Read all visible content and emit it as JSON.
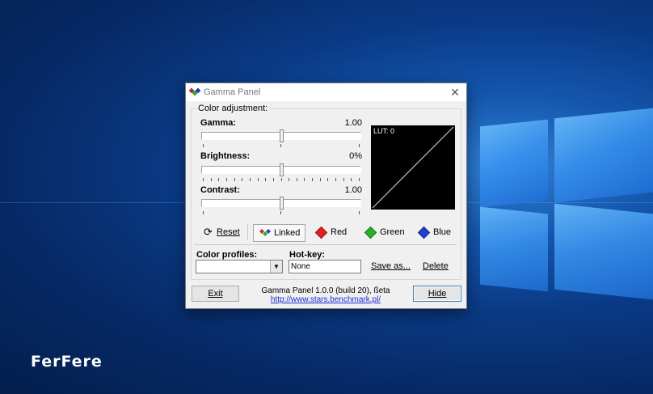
{
  "window": {
    "title": "Gamma Panel",
    "close_glyph": "✕"
  },
  "color_adjustment": {
    "group_title": "Color adjustment:",
    "gamma": {
      "label": "Gamma:",
      "value": "1.00",
      "level": 0.5
    },
    "brightness": {
      "label": "Brightness:",
      "value": "0%",
      "level": 0.5
    },
    "contrast": {
      "label": "Contrast:",
      "value": "1.00",
      "level": 0.5
    },
    "lut": {
      "label": "LUT: 0"
    }
  },
  "channels": {
    "reset": {
      "label": "Reset",
      "icon": "refresh-icon"
    },
    "linked": {
      "label": "Linked",
      "icon": "rgb-diamonds-icon",
      "pressed": true
    },
    "red": {
      "label": "Red",
      "icon": "red-diamond-icon",
      "color": "#e02020"
    },
    "green": {
      "label": "Green",
      "icon": "green-diamond-icon",
      "color": "#28b028"
    },
    "blue": {
      "label": "Blue",
      "icon": "blue-diamond-icon",
      "color": "#1f3fd0"
    }
  },
  "profiles": {
    "label": "Color profiles:",
    "selected": "",
    "hotkey_label": "Hot-key:",
    "hotkey_value": "None",
    "save_as": "Save as...",
    "delete": "Delete"
  },
  "footer": {
    "exit": "Exit",
    "hide": "Hide",
    "version": "Gamma Panel 1.0.0 (build 20), ßeta",
    "url": "http://www.stars.benchmark.pl/"
  },
  "desktop": {
    "brand": "FerFere"
  }
}
